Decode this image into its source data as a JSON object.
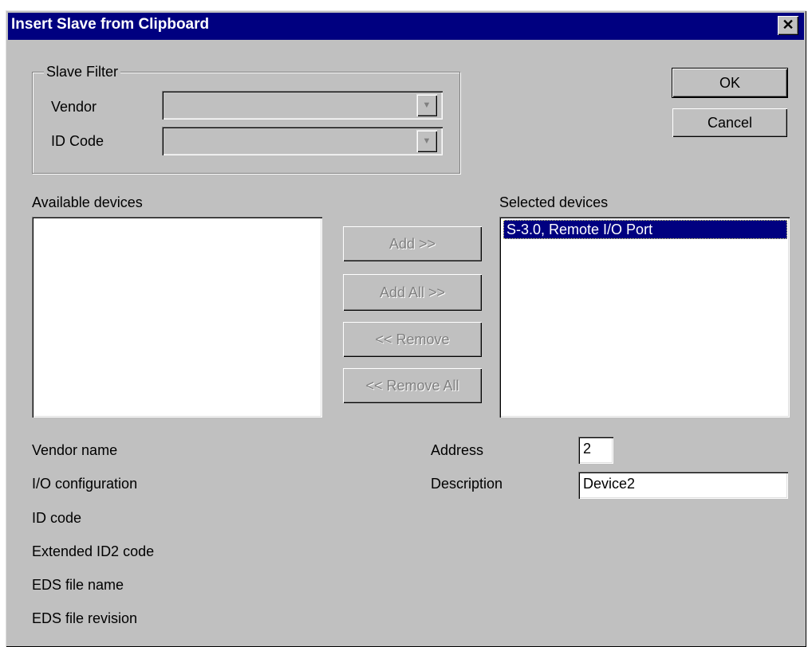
{
  "window": {
    "title": "Insert Slave from Clipboard",
    "close_glyph": "✕"
  },
  "slave_filter": {
    "group_label": "Slave Filter",
    "vendor_label": "Vendor",
    "vendor_value": "",
    "id_code_label": "ID Code",
    "id_code_value": ""
  },
  "buttons": {
    "ok": "OK",
    "cancel": "Cancel",
    "add": "Add >>",
    "add_all": "Add All >>",
    "remove": "<< Remove",
    "remove_all": "<< Remove All"
  },
  "available_devices": {
    "label": "Available devices",
    "items": []
  },
  "selected_devices": {
    "label": "Selected devices",
    "items": [
      "S-3.0, Remote I/O Port"
    ],
    "selected_index": 0
  },
  "details": {
    "vendor_name_label": "Vendor name",
    "io_configuration_label": "I/O configuration",
    "id_code_label": "ID code",
    "extended_id2_label": "Extended ID2 code",
    "eds_file_name_label": "EDS file name",
    "eds_file_revision_label": "EDS file revision"
  },
  "device_settings": {
    "address_label": "Address",
    "address_value": "2",
    "description_label": "Description",
    "description_value": "Device2"
  },
  "colors": {
    "titlebar": "#000080",
    "dialog_face": "#c0c0c0",
    "selection": "#000080"
  }
}
